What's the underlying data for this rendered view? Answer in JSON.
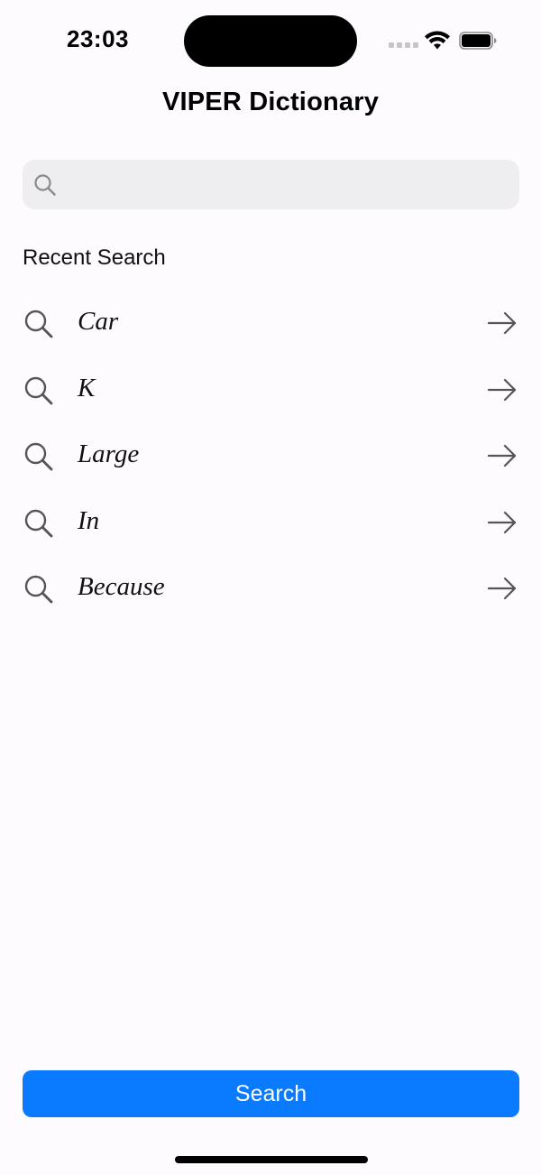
{
  "status_bar": {
    "time": "23:03",
    "wifi_icon": "wifi-icon",
    "battery_icon": "battery-icon"
  },
  "nav": {
    "title": "VIPER Dictionary"
  },
  "search": {
    "value": "",
    "placeholder": "",
    "icon": "search-icon"
  },
  "recent": {
    "header": "Recent Search",
    "items": [
      {
        "label": "Car"
      },
      {
        "label": "K"
      },
      {
        "label": "Large"
      },
      {
        "label": "In"
      },
      {
        "label": "Because"
      }
    ]
  },
  "actions": {
    "search_label": "Search"
  },
  "colors": {
    "background": "#fdfbfe",
    "search_field": "#eeedf0",
    "accent": "#0a7aff",
    "icon": "#555555"
  }
}
